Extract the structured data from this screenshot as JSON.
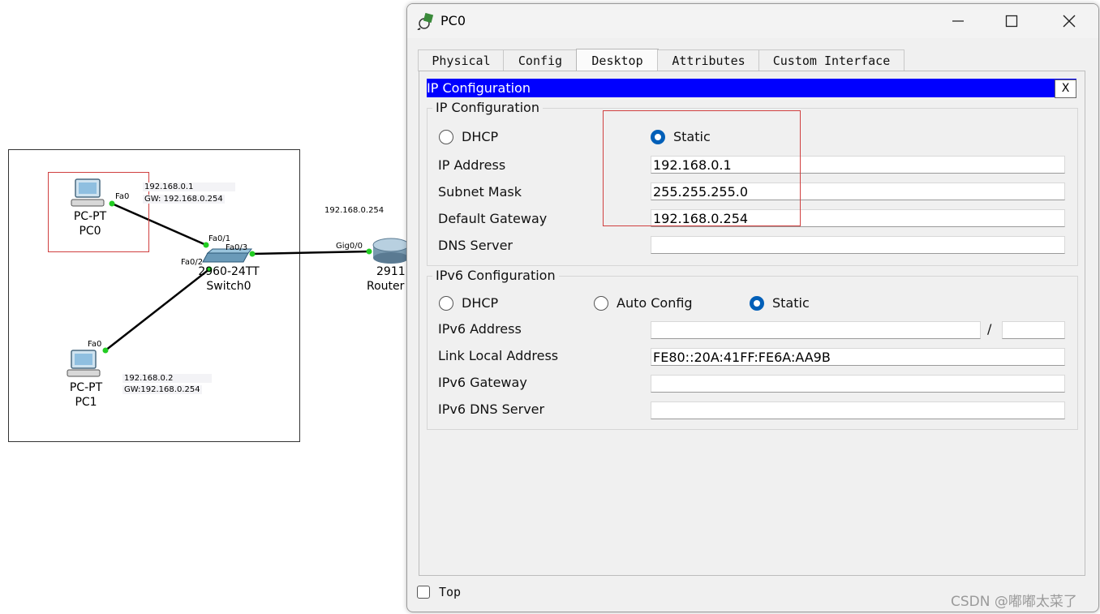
{
  "topology": {
    "pc0": {
      "type": "PC-PT",
      "name": "PC0",
      "port": "Fa0",
      "ip": "192.168.0.1",
      "gw": "GW: 192.168.0.254"
    },
    "pc1": {
      "type": "PC-PT",
      "name": "PC1",
      "port": "Fa0",
      "ip": "192.168.0.2",
      "gw": "GW:192.168.0.254"
    },
    "switch": {
      "type": "2960-24TT",
      "name": "Switch0",
      "port1": "Fa0/1",
      "port2": "Fa0/2",
      "port3": "Fa0/3"
    },
    "router": {
      "type": "2911",
      "name": "Router",
      "port": "Gig0/0",
      "ip": "192.168.0.254"
    },
    "link_color": "#000000",
    "port_dot_color": "#22cc22"
  },
  "window": {
    "title": "PC0",
    "tabs": [
      "Physical",
      "Config",
      "Desktop",
      "Attributes",
      "Custom Interface"
    ],
    "active_tab": "Desktop",
    "app_title": "IP Configuration",
    "app_close": "X",
    "ipv4": {
      "group_title": "IP Configuration",
      "dhcp_label": "DHCP",
      "static_label": "Static",
      "selected": "Static",
      "ip_label": "IP Address",
      "ip_value": "192.168.0.1",
      "mask_label": "Subnet Mask",
      "mask_value": "255.255.255.0",
      "gateway_label": "Default Gateway",
      "gateway_value": "192.168.0.254",
      "dns_label": "DNS Server",
      "dns_value": ""
    },
    "ipv6": {
      "group_title": "IPv6 Configuration",
      "dhcp_label": "DHCP",
      "auto_label": "Auto Config",
      "static_label": "Static",
      "selected": "Static",
      "addr_label": "IPv6 Address",
      "addr_value": "",
      "prefix_sep": "/",
      "prefix_value": "",
      "link_local_label": "Link Local Address",
      "link_local_value": "FE80::20A:41FF:FE6A:AA9B",
      "gateway_label": "IPv6 Gateway",
      "gateway_value": "",
      "dns_label": "IPv6 DNS Server",
      "dns_value": ""
    },
    "top_checkbox_label": "Top",
    "accent_color": "#0000ff",
    "radio_color": "#005fb8"
  },
  "watermark": "CSDN @嘟嘟太菜了"
}
